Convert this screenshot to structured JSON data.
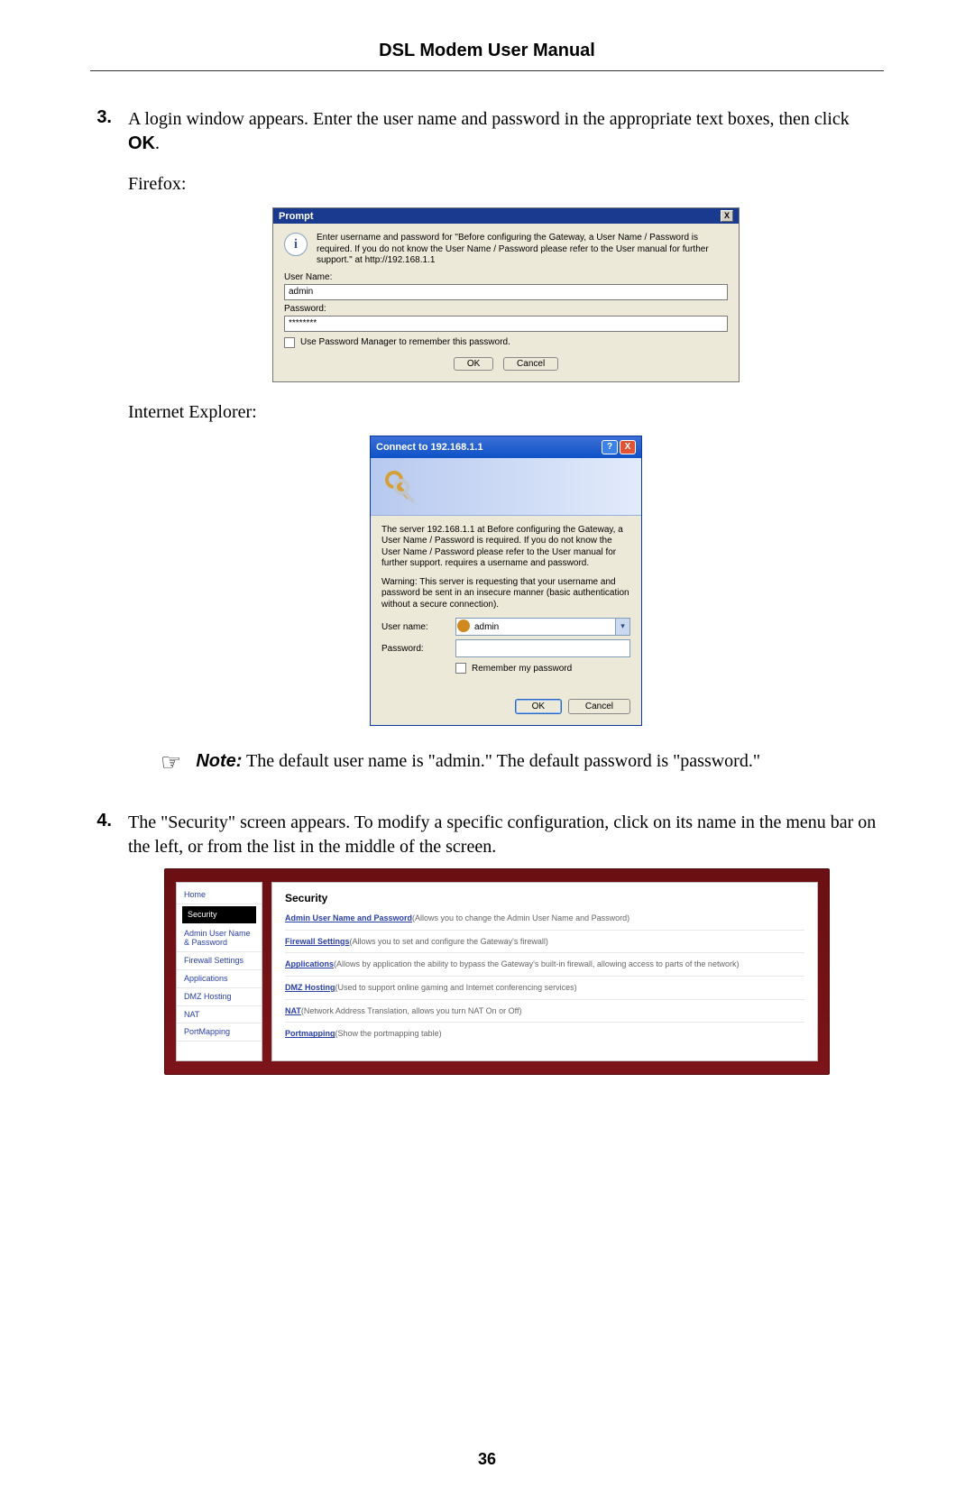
{
  "header": {
    "title": "DSL Modem User Manual"
  },
  "page_number": "36",
  "step3": {
    "number": "3.",
    "text_a": "A login window appears. Enter the user name and password in the appropriate text boxes, then click ",
    "text_bold": "OK",
    "text_b": ".",
    "firefox_label": "Firefox:",
    "ie_label": "Internet Explorer:"
  },
  "ff": {
    "title": "Prompt",
    "close": "X",
    "info": "i",
    "msg": "Enter username and password for \"Before configuring the Gateway, a User Name / Password is required. If you do not know the User Name / Password please refer to the User manual for further support.\" at http://192.168.1.1",
    "user_label": "User Name:",
    "user_value": "admin",
    "pass_label": "Password:",
    "pass_value": "********",
    "check_label": "Use Password Manager to remember this password.",
    "ok": "OK",
    "cancel": "Cancel"
  },
  "ie": {
    "title": "Connect to 192.168.1.1",
    "help": "?",
    "close": "X",
    "msg1": "The server 192.168.1.1 at Before configuring the Gateway, a User Name / Password is required. If you do not know the User Name / Password please refer to the User manual for further support. requires a username and password.",
    "msg2": "Warning: This server is requesting that your username and password be sent in an insecure manner (basic authentication without a secure connection).",
    "user_label": "User name:",
    "user_value": "admin",
    "pass_label": "Password:",
    "pass_value": "",
    "check_label": "Remember my password",
    "ok": "OK",
    "cancel": "Cancel"
  },
  "note": {
    "icon": "☞",
    "bold": "Note:",
    "text": " The default user name is \"admin.\" The default password is \"password.\""
  },
  "step4": {
    "number": "4.",
    "text": "The \"Security\" screen appears. To modify a specific configuration, click on its name in the menu bar on the left, or from the list in the middle of the screen."
  },
  "sec": {
    "nav": {
      "home": "Home",
      "security": "Security",
      "admin": "Admin User Name & Password",
      "firewall": "Firewall Settings",
      "applications": "Applications",
      "dmz": "DMZ Hosting",
      "nat": "NAT",
      "portmapping": "PortMapping"
    },
    "title": "Security",
    "items": [
      {
        "link": "Admin User Name and Password",
        "desc": "(Allows you to change the Admin User Name and Password)"
      },
      {
        "link": "Firewall Settings",
        "desc": "(Allows you to set and configure the Gateway's firewall)"
      },
      {
        "link": "Applications",
        "desc": "(Allows by application the ability to bypass the Gateway's built-in firewall, allowing access to parts of the network)"
      },
      {
        "link": "DMZ Hosting",
        "desc": "(Used to support online gaming and Internet conferencing services)"
      },
      {
        "link": "NAT",
        "desc": "(Network Address Translation, allows you turn NAT On or Off)"
      },
      {
        "link": "Portmapping",
        "desc": "(Show the portmapping table)"
      }
    ]
  }
}
